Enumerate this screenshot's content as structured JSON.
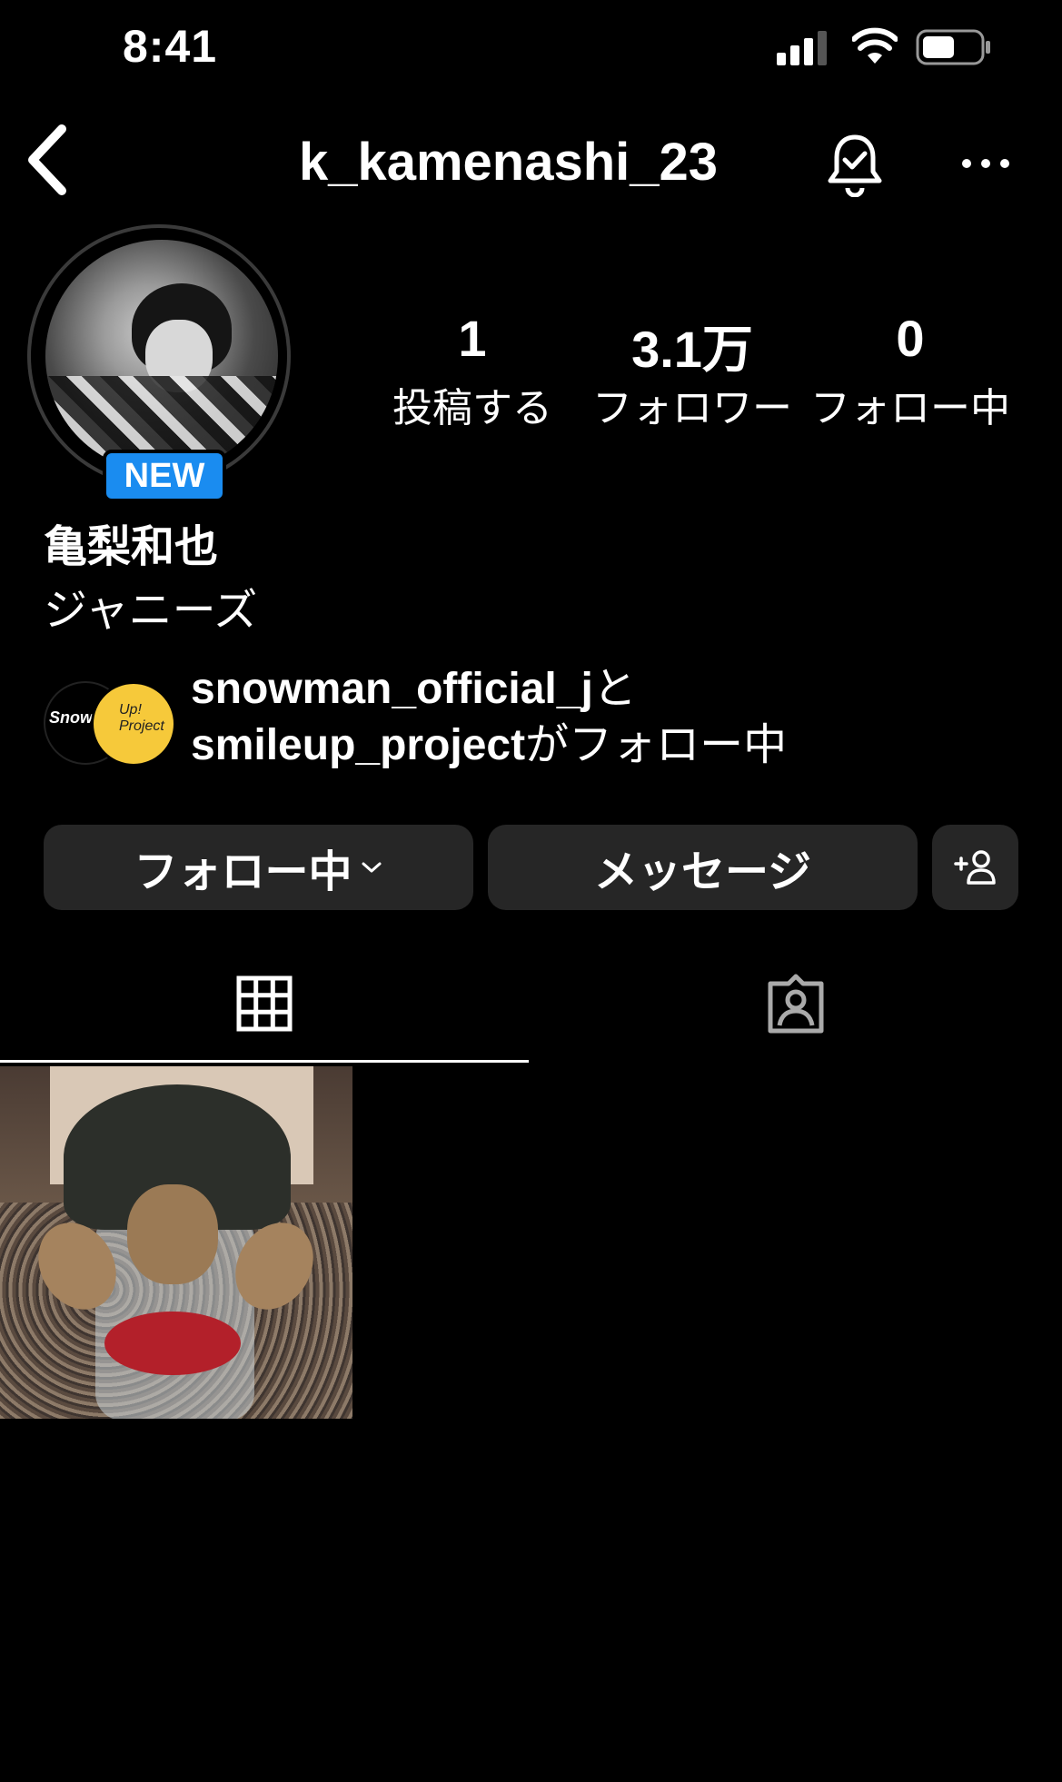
{
  "status_bar": {
    "time": "8:41"
  },
  "header": {
    "username": "k_kamenashi_23"
  },
  "profile": {
    "badge": "NEW",
    "display_name": "亀梨和也",
    "category": "ジャニーズ"
  },
  "stats": {
    "posts": {
      "value": "1",
      "label": "投稿する"
    },
    "followers": {
      "value": "3.1万",
      "label": "フォロワー"
    },
    "following": {
      "value": "0",
      "label": "フォロー中"
    }
  },
  "mutual": {
    "user1": "snowman_official_j",
    "connector": "と",
    "user2": "smileup_project",
    "suffix": "がフォロー中",
    "avatar1_text": "SnowMan",
    "avatar2_text": "Up! Project"
  },
  "buttons": {
    "follow": "フォロー中",
    "message": "メッセージ"
  },
  "icons": {
    "back": "chevron-left-icon",
    "bell": "bell-check-icon",
    "more": "more-dots-icon",
    "add_user": "add-user-icon",
    "grid": "grid-icon",
    "tagged": "tagged-person-icon"
  }
}
